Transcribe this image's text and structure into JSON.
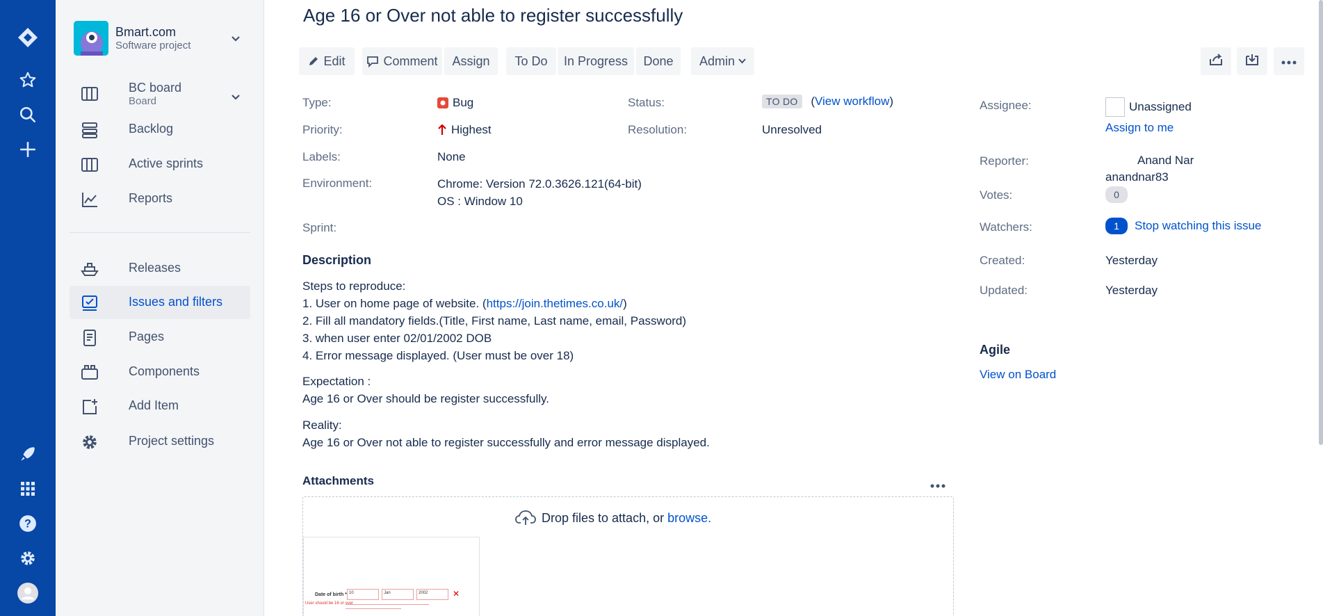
{
  "project": {
    "name": "Bmart.com",
    "type": "Software project"
  },
  "sidebar": {
    "board": {
      "label": "BC board",
      "sub": "Board"
    },
    "items": [
      {
        "label": "Backlog"
      },
      {
        "label": "Active sprints"
      },
      {
        "label": "Reports"
      },
      {
        "label": "Releases"
      },
      {
        "label": "Issues and filters"
      },
      {
        "label": "Pages"
      },
      {
        "label": "Components"
      },
      {
        "label": "Add Item"
      },
      {
        "label": "Project settings"
      }
    ]
  },
  "issue": {
    "title": "Age 16 or Over not able to register successfully"
  },
  "toolbar": {
    "edit": "Edit",
    "comment": "Comment",
    "assign": "Assign",
    "todo": "To Do",
    "inprogress": "In Progress",
    "done": "Done",
    "admin": "Admin"
  },
  "details": {
    "type_label": "Type:",
    "type_value": "Bug",
    "priority_label": "Priority:",
    "priority_value": "Highest",
    "labels_label": "Labels:",
    "labels_value": "None",
    "environment_label": "Environment:",
    "environment_line1": "Chrome: Version 72.0.3626.121(64-bit)",
    "environment_line2": "OS : Window 10",
    "sprint_label": "Sprint:",
    "status_label": "Status:",
    "status_value": "TO DO",
    "view_workflow_open": "(",
    "view_workflow": "View workflow",
    "view_workflow_close": ")",
    "resolution_label": "Resolution:",
    "resolution_value": "Unresolved"
  },
  "description": {
    "heading": "Description",
    "steps_heading": "Steps to reproduce:",
    "step1_prefix": "1. User on home page of website. (",
    "step1_link": "https://join.thetimes.co.uk/",
    "step1_suffix": ")",
    "step2": "2. Fill all mandatory fields.(Title, First name, Last name, email, Password)",
    "step3": "3. when user enter 02/01/2002 DOB",
    "step4": "4. Error message displayed. (User must be over 18)",
    "expectation_heading": "Expectation :",
    "expectation": "Age 16 or Over should be register successfully.",
    "reality_heading": "Reality:",
    "reality": "Age 16 or Over not able to register successfully and error message displayed."
  },
  "attachments": {
    "heading": "Attachments",
    "drop_text": "Drop files to attach, or ",
    "browse": "browse.",
    "thumb": {
      "dob_label": "Date of birth *",
      "day": "10",
      "month": "Jan",
      "year": "2002",
      "error": "User should be 16 or over"
    }
  },
  "people": {
    "assignee_label": "Assignee:",
    "assignee": "Unassigned",
    "assign_to_me": "Assign to me",
    "reporter_label": "Reporter:",
    "reporter_name": "Anand Nar",
    "reporter_user": "anandnar83",
    "votes_label": "Votes:",
    "votes": "0",
    "watchers_label": "Watchers:",
    "watchers": "1",
    "stop_watching": "Stop watching this issue"
  },
  "dates": {
    "created_label": "Created:",
    "created": "Yesterday",
    "updated_label": "Updated:",
    "updated": "Yesterday"
  },
  "agile": {
    "heading": "Agile",
    "view_on_board": "View on Board"
  },
  "colors": {
    "globalnav": "#0747a6",
    "link": "#0052cc",
    "bug": "#e5493a",
    "priority_highest": "#ce0000"
  }
}
